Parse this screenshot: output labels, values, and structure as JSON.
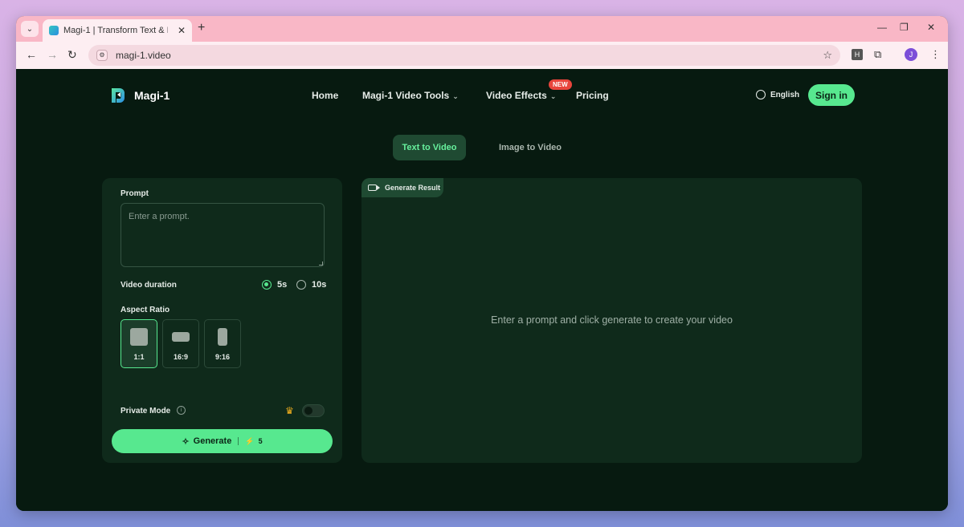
{
  "browser": {
    "tab_title": "Magi-1 | Transform Text & Image",
    "tab_close": "✕",
    "new_tab": "+",
    "url": "magi-1.video",
    "extension_label": "H",
    "profile_initial": "J"
  },
  "header": {
    "brand": "Magi-1",
    "nav": {
      "home": "Home",
      "video_tools": "Magi-1 Video Tools",
      "video_effects": "Video Effects",
      "new_badge": "NEW",
      "pricing": "Pricing"
    },
    "language": "English",
    "sign_in": "Sign in"
  },
  "modes": {
    "text_to_video": "Text to Video",
    "image_to_video": "Image to Video"
  },
  "form": {
    "prompt_label": "Prompt",
    "prompt_placeholder": "Enter a prompt.",
    "duration_label": "Video duration",
    "duration_options": [
      "5s",
      "10s"
    ],
    "duration_selected": "5s",
    "aspect_label": "Aspect Ratio",
    "aspect_options": [
      "1:1",
      "16:9",
      "9:16"
    ],
    "aspect_selected": "1:1",
    "private_mode_label": "Private Mode",
    "private_mode_on": false,
    "generate_label": "Generate",
    "generate_cost": "5"
  },
  "result": {
    "tab_label": "Generate Result",
    "empty_message": "Enter a prompt and click generate to create your video"
  },
  "colors": {
    "accent": "#57e88f",
    "background": "#071a10",
    "panel": "#0f2a1b",
    "badge": "#e8453c"
  }
}
